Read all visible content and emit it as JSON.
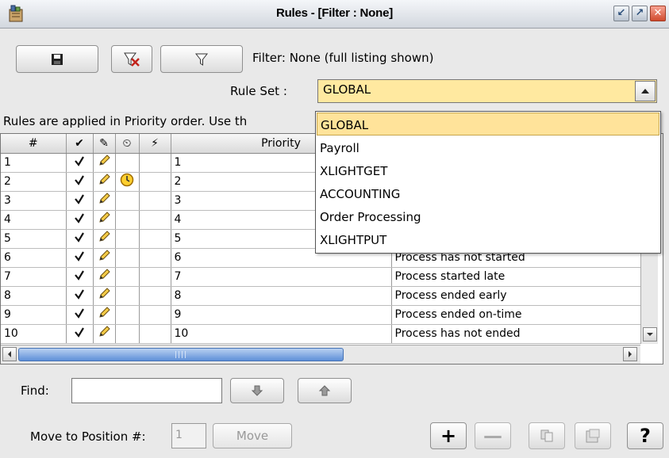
{
  "window": {
    "title": "Rules - [Filter : None]",
    "buttons": [
      "minimize",
      "maximize",
      "close"
    ]
  },
  "toolbar": {
    "save_icon": "floppy-disk-icon",
    "clear_filter_icon": "clear-filter-icon",
    "filter_icon": "funnel-icon",
    "filter_status": "Filter: None (full listing shown)"
  },
  "rule_set": {
    "label": "Rule Set :",
    "value": "GLOBAL",
    "options": [
      "GLOBAL",
      "Payroll",
      "XLIGHTGET",
      "ACCOUNTING",
      "Order Processing",
      "XLIGHTPUT"
    ],
    "selected_index": 0,
    "highlight_color": "#ffe39a"
  },
  "info": "Rules are applied in Priority order.  Use th",
  "table": {
    "headers": [
      "#",
      "✔",
      "✎",
      "⏲",
      "⚡",
      "Priority",
      ""
    ],
    "rows": [
      {
        "num": "1",
        "enabled": true,
        "edit": true,
        "clock": false,
        "priority": "1",
        "desc": ""
      },
      {
        "num": "2",
        "enabled": true,
        "edit": true,
        "clock": true,
        "priority": "2",
        "desc": ""
      },
      {
        "num": "3",
        "enabled": true,
        "edit": true,
        "clock": false,
        "priority": "3",
        "desc": ""
      },
      {
        "num": "4",
        "enabled": true,
        "edit": true,
        "clock": false,
        "priority": "4",
        "desc": ""
      },
      {
        "num": "5",
        "enabled": true,
        "edit": true,
        "clock": false,
        "priority": "5",
        "desc": ""
      },
      {
        "num": "6",
        "enabled": true,
        "edit": true,
        "clock": false,
        "priority": "6",
        "desc": "Process has not started"
      },
      {
        "num": "7",
        "enabled": true,
        "edit": true,
        "clock": false,
        "priority": "7",
        "desc": "Process started late"
      },
      {
        "num": "8",
        "enabled": true,
        "edit": true,
        "clock": false,
        "priority": "8",
        "desc": "Process ended early"
      },
      {
        "num": "9",
        "enabled": true,
        "edit": true,
        "clock": false,
        "priority": "9",
        "desc": "Process ended on-time"
      },
      {
        "num": "10",
        "enabled": true,
        "edit": true,
        "clock": false,
        "priority": "10",
        "desc": "Process has not ended"
      }
    ]
  },
  "find": {
    "label": "Find:",
    "value": "",
    "down_icon": "arrow-down-icon",
    "up_icon": "arrow-up-icon"
  },
  "move": {
    "label": "Move to Position #:",
    "position": "1",
    "button": "Move"
  },
  "actions": {
    "add": "+",
    "remove": "—",
    "copy_icon": "copy-icon",
    "properties_icon": "properties-icon",
    "help": "?"
  }
}
